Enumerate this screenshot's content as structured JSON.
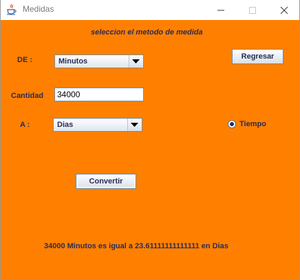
{
  "window": {
    "title": "Medidas"
  },
  "form": {
    "header": "seleccion el metodo de medida",
    "de_label": "DE :",
    "de_selected": "Minutos",
    "cantidad_label": "Cantidad",
    "cantidad_value": "34000",
    "a_label": "A :",
    "a_selected": "Dias",
    "regresar_label": "Regresar",
    "tiempo_label": "Tiempo",
    "tiempo_selected": true,
    "convertir_label": "Convertir",
    "result_text": "34000 Minutos  es igual a 23.61111111111111 en  Dias"
  },
  "colors": {
    "background": "#ff8000",
    "label_text": "#2b2b55"
  },
  "icons": {
    "app": "java-coffee-cup-icon",
    "minimize": "minimize-icon",
    "maximize": "maximize-icon",
    "close": "close-icon",
    "dropdown": "chevron-down-icon"
  }
}
